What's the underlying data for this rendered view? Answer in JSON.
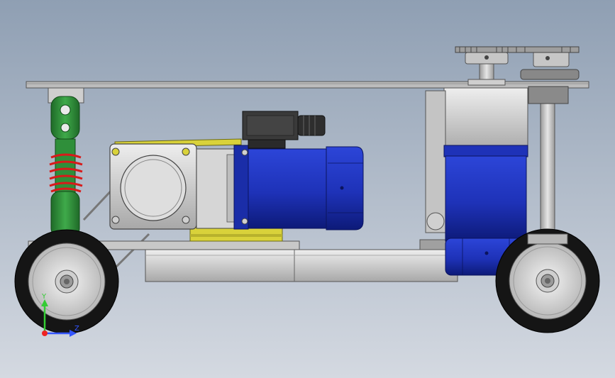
{
  "viewport": {
    "background_top": "#8f9fb3",
    "background_bottom": "#d4d9e1"
  },
  "colors": {
    "motor_blue": "#1e32b8",
    "motor_blue_dark": "#0d1a78",
    "spring_red": "#d81a1a",
    "damper_green": "#2f8f3a",
    "mount_yellow": "#d9d23a",
    "metal_light": "#d8d8d8",
    "metal_mid": "#b5b5b5",
    "metal_dark": "#6e6e6e",
    "tire": "#151515",
    "connector": "#333333"
  },
  "triad": {
    "y_label": "Y",
    "z_label": "Z",
    "y_color": "#33cc33",
    "z_color": "#3355ff",
    "x_color": "#ee2222"
  }
}
